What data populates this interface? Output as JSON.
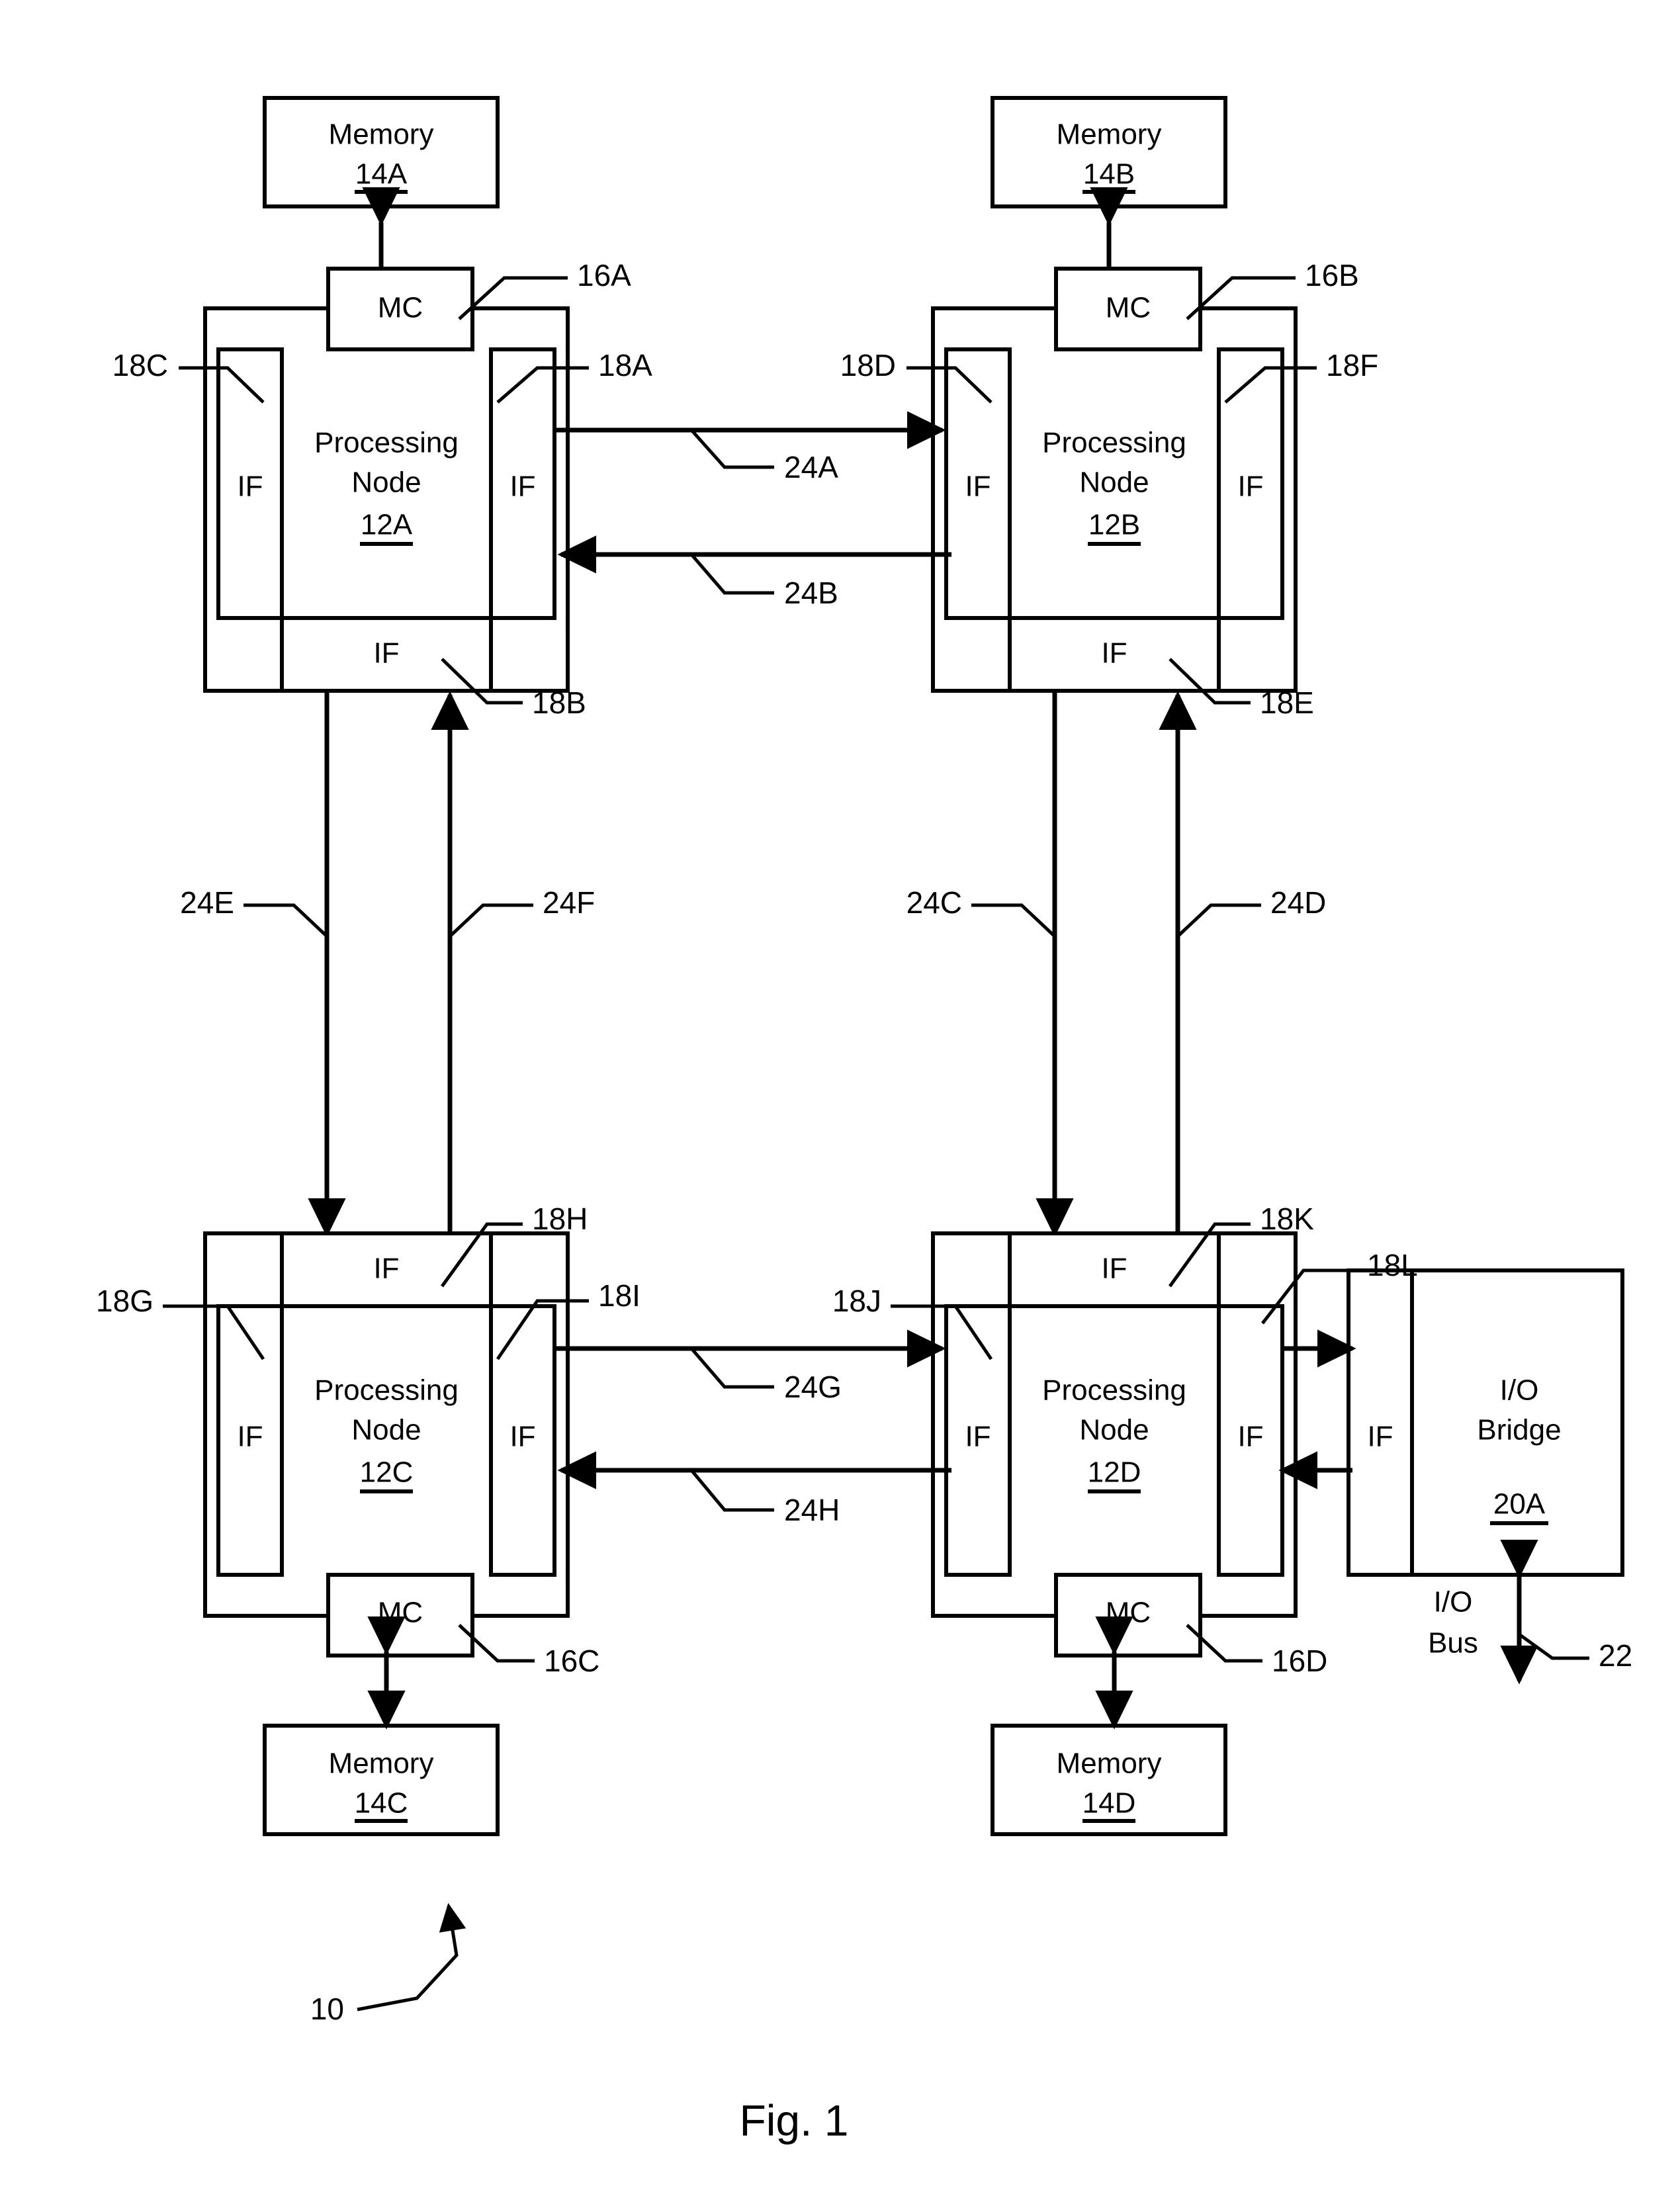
{
  "figure": {
    "caption": "Fig. 1",
    "system_ref": "10"
  },
  "memories": [
    {
      "id": "mem-14a",
      "label": "Memory",
      "ref": "14A"
    },
    {
      "id": "mem-14b",
      "label": "Memory",
      "ref": "14B"
    },
    {
      "id": "mem-14c",
      "label": "Memory",
      "ref": "14C"
    },
    {
      "id": "mem-14d",
      "label": "Memory",
      "ref": "14D"
    }
  ],
  "nodes": [
    {
      "id": "node-12a",
      "line1": "Processing",
      "line2": "Node",
      "ref": "12A"
    },
    {
      "id": "node-12b",
      "line1": "Processing",
      "line2": "Node",
      "ref": "12B"
    },
    {
      "id": "node-12c",
      "line1": "Processing",
      "line2": "Node",
      "ref": "12C"
    },
    {
      "id": "node-12d",
      "line1": "Processing",
      "line2": "Node",
      "ref": "12D"
    }
  ],
  "memory_controllers": [
    {
      "id": "mc-16a",
      "label": "MC",
      "ref": "16A"
    },
    {
      "id": "mc-16b",
      "label": "MC",
      "ref": "16B"
    },
    {
      "id": "mc-16c",
      "label": "MC",
      "ref": "16C"
    },
    {
      "id": "mc-16d",
      "label": "MC",
      "ref": "16D"
    }
  ],
  "interfaces": [
    {
      "id": "if-18a",
      "label": "IF",
      "ref": "18A"
    },
    {
      "id": "if-18b",
      "label": "IF",
      "ref": "18B"
    },
    {
      "id": "if-18c",
      "label": "IF",
      "ref": "18C"
    },
    {
      "id": "if-18d",
      "label": "IF",
      "ref": "18D"
    },
    {
      "id": "if-18e",
      "label": "IF",
      "ref": "18E"
    },
    {
      "id": "if-18f",
      "label": "IF",
      "ref": "18F"
    },
    {
      "id": "if-18g",
      "label": "IF",
      "ref": "18G"
    },
    {
      "id": "if-18h",
      "label": "IF",
      "ref": "18H"
    },
    {
      "id": "if-18i",
      "label": "IF",
      "ref": "18I"
    },
    {
      "id": "if-18j",
      "label": "IF",
      "ref": "18J"
    },
    {
      "id": "if-18k",
      "label": "IF",
      "ref": "18K"
    },
    {
      "id": "if-18l",
      "label": "IF",
      "ref": "18L"
    }
  ],
  "io_bridge": {
    "id": "io-bridge-20a",
    "line1": "I/O",
    "line2": "Bridge",
    "ref": "20A"
  },
  "io_bus": {
    "id": "io-bus-22",
    "line1": "I/O",
    "line2": "Bus",
    "ref": "22"
  },
  "links": [
    {
      "id": "link-24a",
      "ref": "24A"
    },
    {
      "id": "link-24b",
      "ref": "24B"
    },
    {
      "id": "link-24c",
      "ref": "24C"
    },
    {
      "id": "link-24d",
      "ref": "24D"
    },
    {
      "id": "link-24e",
      "ref": "24E"
    },
    {
      "id": "link-24f",
      "ref": "24F"
    },
    {
      "id": "link-24g",
      "ref": "24G"
    },
    {
      "id": "link-24h",
      "ref": "24H"
    }
  ],
  "colors": {
    "ink": "#000000",
    "paper": "#ffffff"
  }
}
